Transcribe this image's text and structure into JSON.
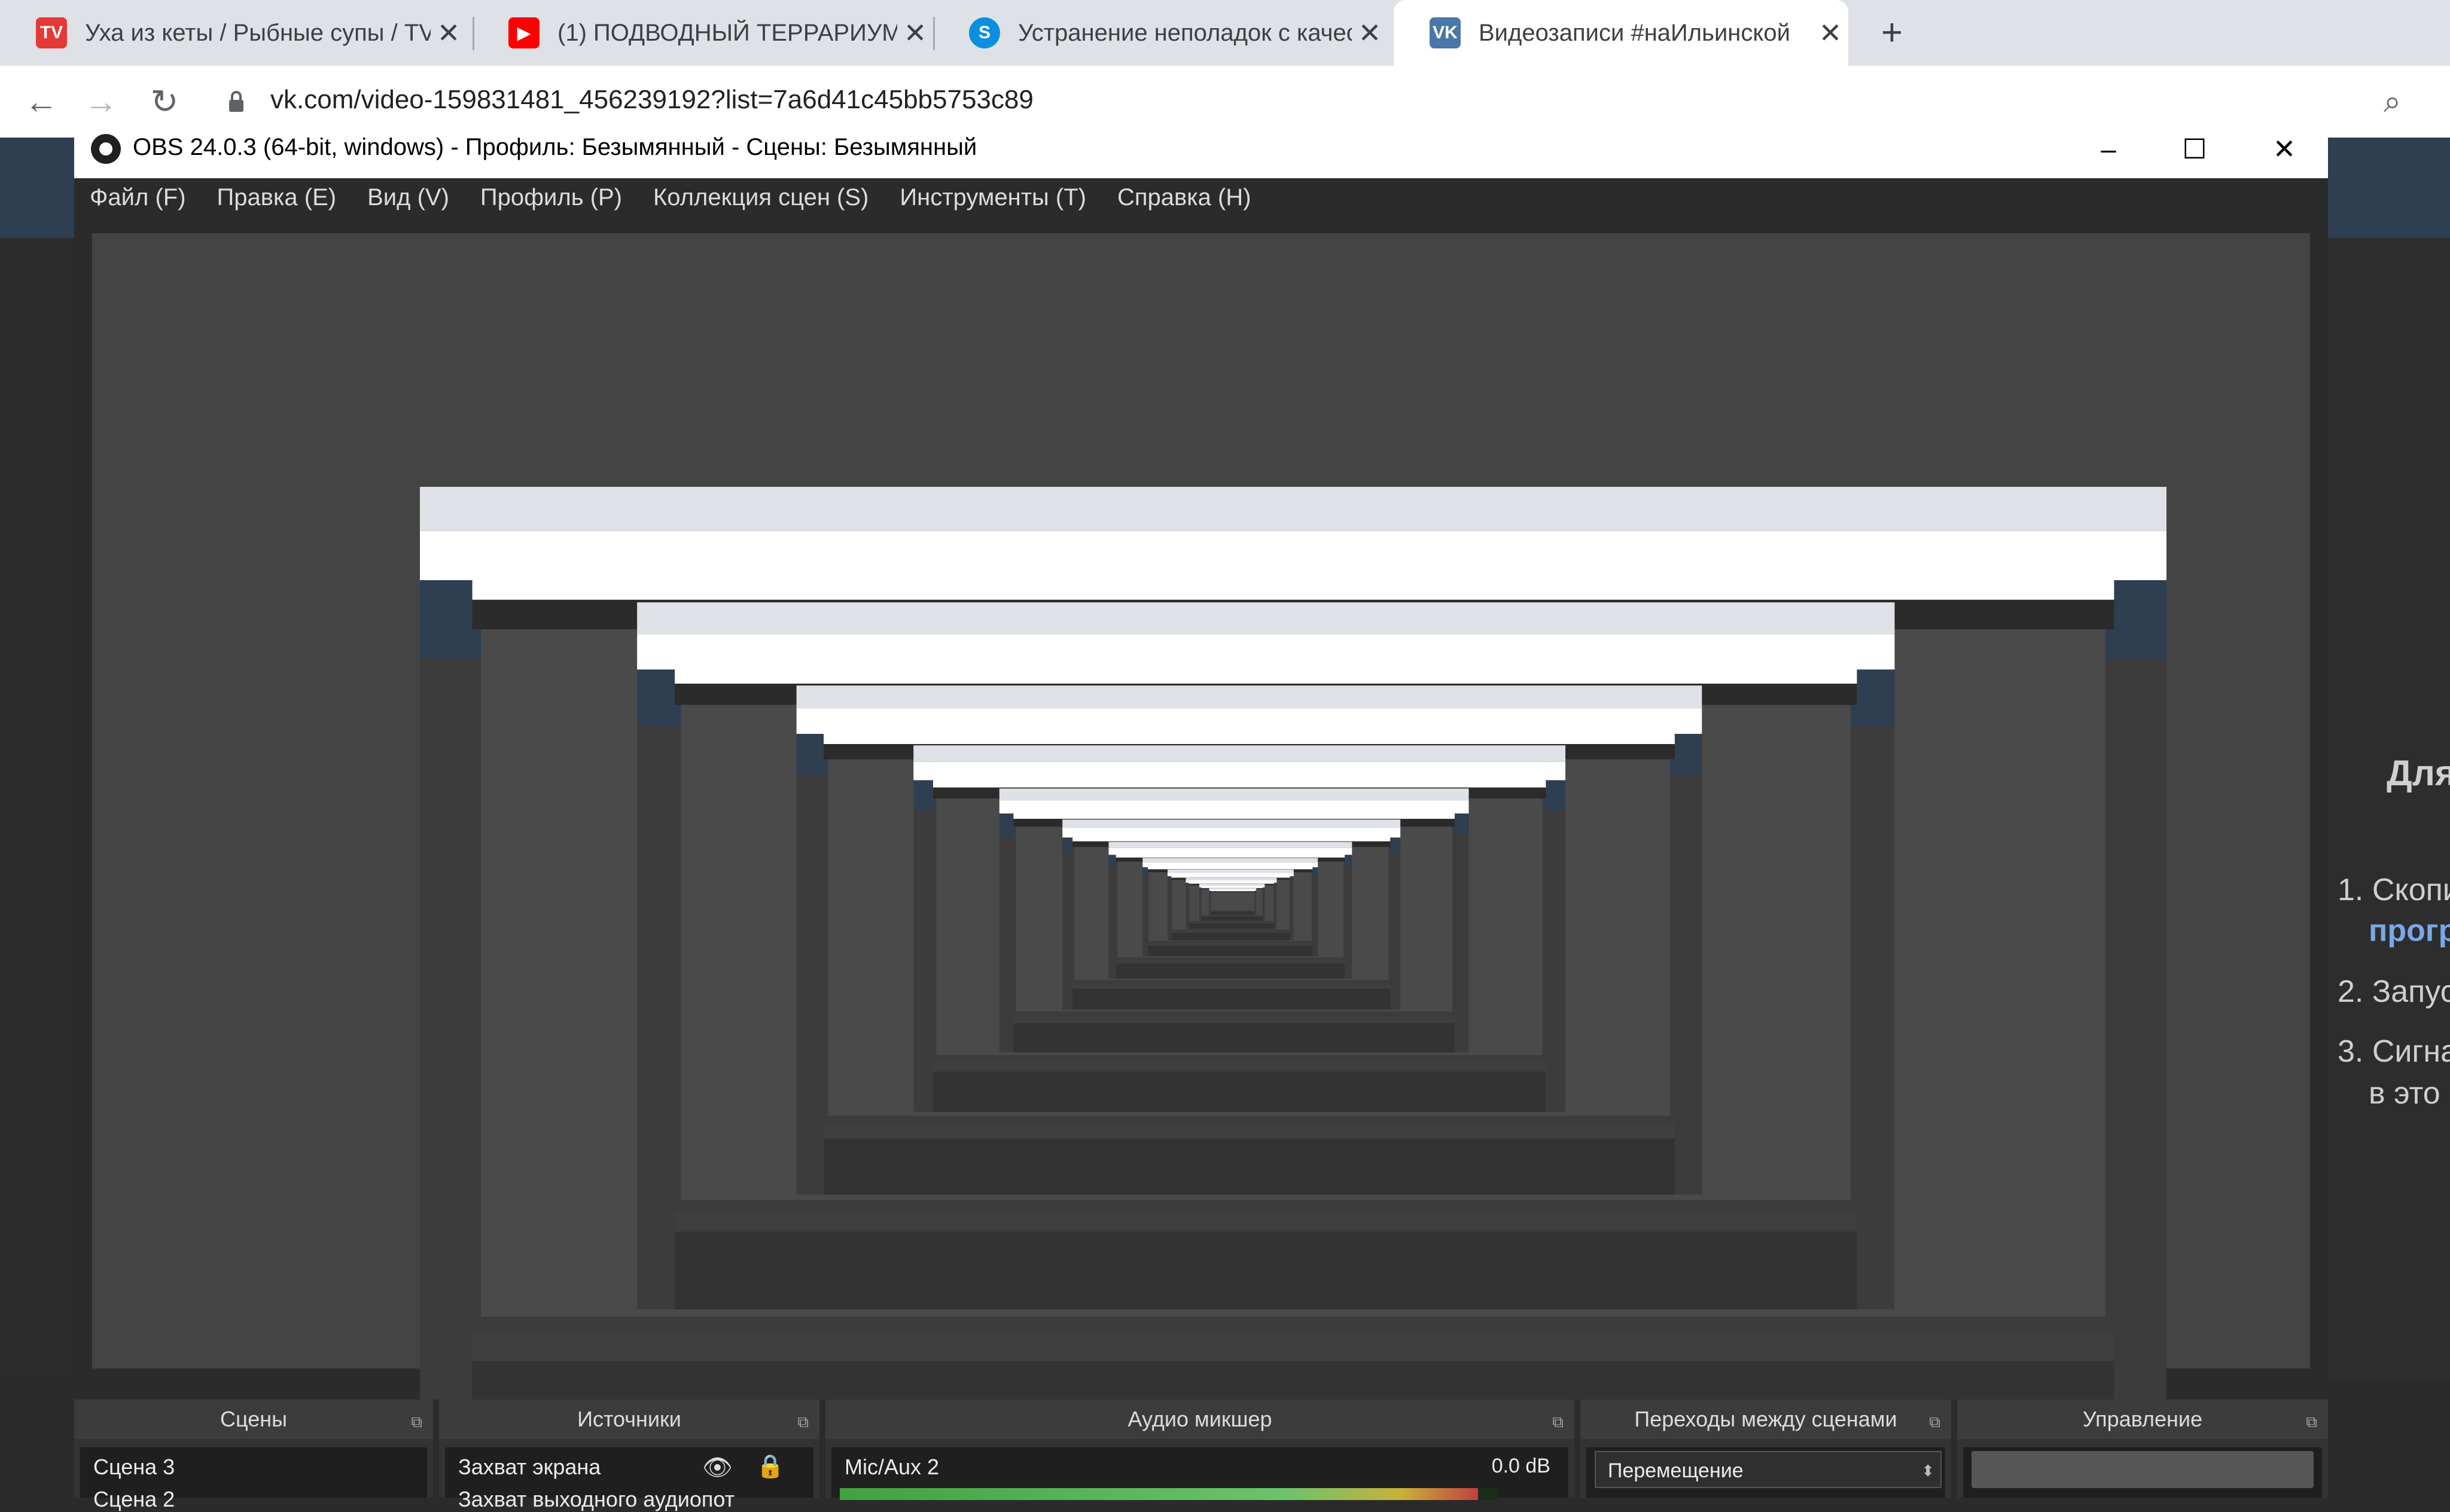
{
  "browser": {
    "tabs": [
      {
        "label": "Уха из кеты / Рыбные супы / TV",
        "icon": "tv-icon",
        "color": "#e53935",
        "active": false
      },
      {
        "label": "(1) ПОДВОДНЫЙ ТЕРРАРИУМ, Р",
        "icon": "youtube-icon",
        "color": "#ff0000",
        "active": false
      },
      {
        "label": "Устранение неполадок с качест",
        "icon": "skype-icon",
        "color": "#0d8fe0",
        "active": false
      },
      {
        "label": "Видеозаписи #наИльинской",
        "icon": "vk-icon",
        "color": "#4a76a8",
        "active": true
      }
    ],
    "tab_close": "✕",
    "new_tab": "+",
    "url": "vk.com/video-159831481_456239192?list=7a6d41c45bb5753c89"
  },
  "obs": {
    "title": "OBS 24.0.3 (64-bit, windows) - Профиль: Безымянный - Сцены: Безымянный",
    "menu": [
      "Файл (F)",
      "Правка (E)",
      "Вид (V)",
      "Профиль (P)",
      "Коллекция сцен (S)",
      "Инструменты (T)",
      "Справка (H)"
    ],
    "docks": {
      "scenes": {
        "title": "Сцены",
        "item1": "Сцена 3",
        "item2": "Сцена 2"
      },
      "sources": {
        "title": "Источники",
        "item1": "Захват экрана",
        "item2": "Захват выходного аудиопот"
      },
      "mixer": {
        "title": "Аудио микшер",
        "channel": "Mic/Aux 2",
        "level": "0.0 dB",
        "fill": 0.97
      },
      "transitions": {
        "title": "Переходы между сценами",
        "selected": "Перемещение"
      },
      "controls": {
        "title": "Управление"
      }
    }
  },
  "page_right": {
    "heading": "Для",
    "items": [
      "1. Скопи",
      "прогр",
      "2. Запус",
      "3. Сигна",
      "в это"
    ]
  },
  "colors": {
    "vk_bar": "#2f3f52",
    "obs_bg": "#2b2b2b",
    "accent_link": "#7aa7e6"
  }
}
